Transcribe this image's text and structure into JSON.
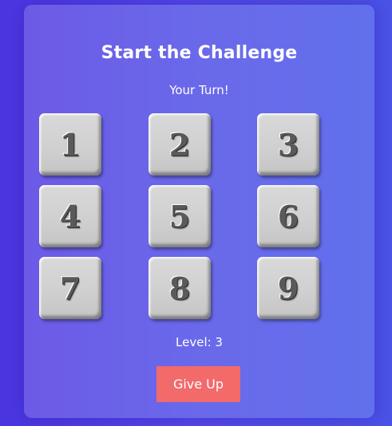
{
  "game": {
    "title": "Start the Challenge",
    "status": "Your Turn!",
    "level_text": "Level: 3",
    "give_up_label": "Give Up"
  },
  "tiles": [
    "1",
    "2",
    "3",
    "4",
    "5",
    "6",
    "7",
    "8",
    "9"
  ],
  "colors": {
    "background": "#4d3ee2",
    "card": "#6866e8",
    "tile": "#d0d0d0",
    "tile_digit": "#5a5a5a",
    "give_up_button": "#f26a6a",
    "text": "#ffffff"
  }
}
